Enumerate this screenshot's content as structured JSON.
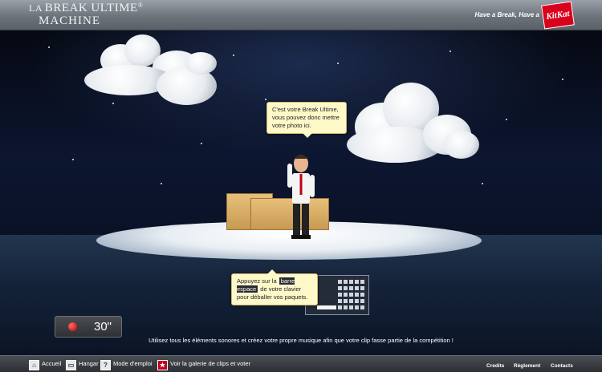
{
  "header": {
    "logo_line1_prefix": "LA",
    "logo_line1_main": "BREAK ULTIME",
    "logo_reg": "®",
    "logo_line2": "MACHINE",
    "tagline": "Have a Break, Have a",
    "brand_badge": "KitKat"
  },
  "stage": {
    "photo_bubble": "C'est votre Break Ultime, vous pouvez donc mettre votre photo ici.",
    "space_bubble_pre": "Appuyez sur la",
    "space_bubble_key": "barre espace",
    "space_bubble_post": "de votre clavier pour déballer vos paquets.",
    "timer_value": "30\"",
    "caption": "Utilisez tous les éléments sonores et créez votre propre musique afin que votre clip fasse partie de la compétition !"
  },
  "bottom_nav": {
    "items": [
      {
        "label": "Accueil",
        "icon": "home-icon"
      },
      {
        "label": "Hangar",
        "icon": "hangar-icon"
      },
      {
        "label": "Mode d'emploi",
        "icon": "help-icon"
      },
      {
        "label": "Voir la galerie de clips et voter",
        "icon": "star-icon"
      }
    ],
    "right_links": [
      "Credits",
      "Règlement",
      "Contacts"
    ]
  },
  "colors": {
    "brand_red": "#d8001c",
    "bubble_bg": "#fff8c8",
    "bar_gray": "#6d737b"
  }
}
